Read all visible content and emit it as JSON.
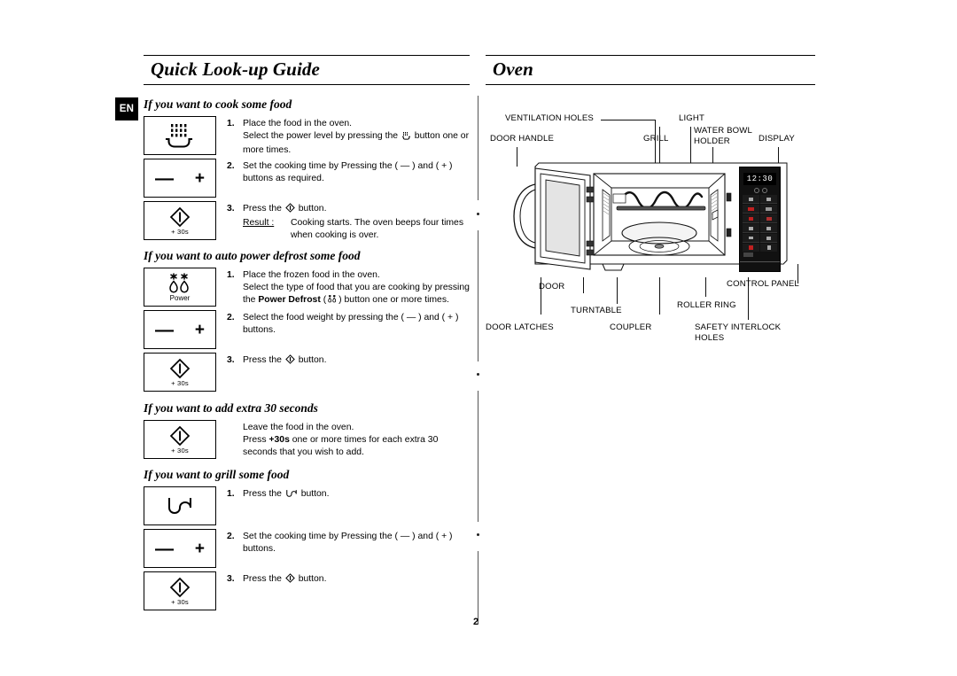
{
  "document": {
    "page_number": "2",
    "language_badge": "EN"
  },
  "left_column": {
    "title": "Quick Look-up Guide",
    "sections": [
      {
        "heading": "If you want to cook some food",
        "steps": [
          {
            "num": "1.",
            "icon": "microwave-cook-icon",
            "icon_label": "",
            "lines": [
              "Place the food in the oven.",
              "Select the power level by pressing the ⓞ button one or more times."
            ],
            "text_a": "Place the food in the oven.",
            "text_b_pre": "Select the power level by pressing the",
            "text_b_post": "button one or more times."
          },
          {
            "num": "2.",
            "icon": "minus-plus-icon",
            "text": "Set the cooking time by Pressing the ( — ) and ( + ) buttons as required."
          },
          {
            "num": "3.",
            "icon": "start-30s-icon",
            "icon_label": "+ 30s",
            "text_pre": "Press the",
            "text_post": "button.",
            "result_label": "Result :",
            "result_text": "Cooking starts. The oven beeps four times when cooking is over."
          }
        ]
      },
      {
        "heading": "If you want to auto power defrost some food",
        "steps": [
          {
            "num": "1.",
            "icon": "power-defrost-icon",
            "icon_label": "Power",
            "text_a": "Place the frozen food in the oven.",
            "text_b_pre": "Select the type of food that you are cooking by pressing the",
            "text_b_bold": "Power Defrost",
            "text_b_post": "button one or more times."
          },
          {
            "num": "2.",
            "icon": "minus-plus-icon",
            "text": "Select the food weight by pressing the ( — ) and ( + ) buttons."
          },
          {
            "num": "3.",
            "icon": "start-30s-icon",
            "icon_label": "+ 30s",
            "text_pre": "Press the",
            "text_post": "button."
          }
        ]
      },
      {
        "heading": "If you want to add extra 30 seconds",
        "steps": [
          {
            "num": "",
            "icon": "start-30s-icon",
            "icon_label": "+ 30s",
            "text_a": "Leave the food in the oven.",
            "text_b_pre": "Press",
            "text_b_bold": "+30s",
            "text_b_post": "one or more times for each extra 30 seconds that you wish to add."
          }
        ]
      },
      {
        "heading": "If you want to grill some food",
        "steps": [
          {
            "num": "1.",
            "icon": "grill-icon",
            "text_pre": "Press the",
            "text_post": "button."
          },
          {
            "num": "2.",
            "icon": "minus-plus-icon",
            "text": "Set the cooking time by Pressing the ( — ) and ( + ) buttons."
          },
          {
            "num": "3.",
            "icon": "start-30s-icon",
            "icon_label": "+ 30s",
            "text_pre": "Press the",
            "text_post": "button."
          }
        ]
      }
    ]
  },
  "right_column": {
    "title": "Oven",
    "diagram_labels": {
      "ventilation_holes": "VENTILATION HOLES",
      "door_handle": "DOOR HANDLE",
      "light": "LIGHT",
      "grill": "GRILL",
      "water_bowl_holder_1": "WATER BOWL",
      "water_bowl_holder_2": "HOLDER",
      "display": "DISPLAY",
      "door": "DOOR",
      "turntable": "TURNTABLE",
      "roller_ring": "ROLLER RING",
      "control_panel": "CONTROL PANEL",
      "door_latches": "DOOR LATCHES",
      "coupler": "COUPLER",
      "safety_interlock_1": "SAFETY INTERLOCK",
      "safety_interlock_2": "HOLES"
    },
    "control_panel": {
      "display_value": "12:30",
      "panel_color": "#111111",
      "display_color": "#ffffff",
      "accent_color": "#d02020"
    }
  }
}
